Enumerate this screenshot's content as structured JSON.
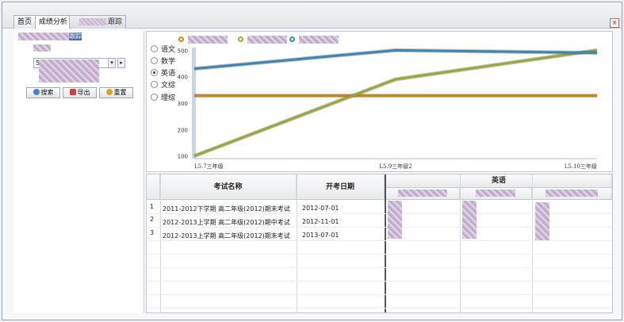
{
  "tabs": [
    {
      "label": "首页"
    },
    {
      "label": "成绩分析"
    },
    {
      "label": "跟踪"
    }
  ],
  "close_label": "x",
  "left_panel": {
    "student_suffix": "跟踪",
    "select_value": "5",
    "select_arrow": "▾",
    "select_next": "▸",
    "buttons": [
      {
        "label": "搜索",
        "icon": "search-icon",
        "color": "#4f7fd0"
      },
      {
        "label": "导出",
        "icon": "export-icon",
        "color": "#d04040"
      },
      {
        "label": "重置",
        "icon": "broom-icon",
        "color": "#e0a020"
      }
    ]
  },
  "subject_radios": [
    {
      "label": "语文",
      "selected": false
    },
    {
      "label": "数学",
      "selected": false
    },
    {
      "label": "英语",
      "selected": true
    },
    {
      "label": "文综",
      "selected": false
    },
    {
      "label": "理综",
      "selected": false
    }
  ],
  "chart_data": {
    "type": "line",
    "categories": [
      "L5.7三年级",
      "L5.9三年级2",
      "L5.10三年级"
    ],
    "yticks": [
      100,
      200,
      300,
      400,
      500
    ],
    "ylim": [
      90,
      510
    ],
    "legend_colors": [
      "#d08a10",
      "#9aaa30",
      "#3a8ab0"
    ],
    "series": [
      {
        "color": "#c8850f",
        "values": [
          328,
          328,
          328
        ]
      },
      {
        "color": "#9aa83a",
        "values": [
          100,
          390,
          500
        ]
      },
      {
        "color": "#3d86b3",
        "values": [
          430,
          500,
          490
        ]
      }
    ]
  },
  "grid": {
    "col_exam": "考试名称",
    "col_date": "开考日期",
    "col_subject": "英语",
    "rows": [
      {
        "num": "1",
        "exam": "2011-2012下学期 高二年级(2012)期末考试",
        "date": "2012-07-01"
      },
      {
        "num": "2",
        "exam": "2012-2013上学期 高二年级(2012)期中考试",
        "date": "2012-11-01"
      },
      {
        "num": "3",
        "exam": "2012-2013上学期 高二年级(2012)期末考试",
        "date": "2013-07-01"
      }
    ]
  }
}
